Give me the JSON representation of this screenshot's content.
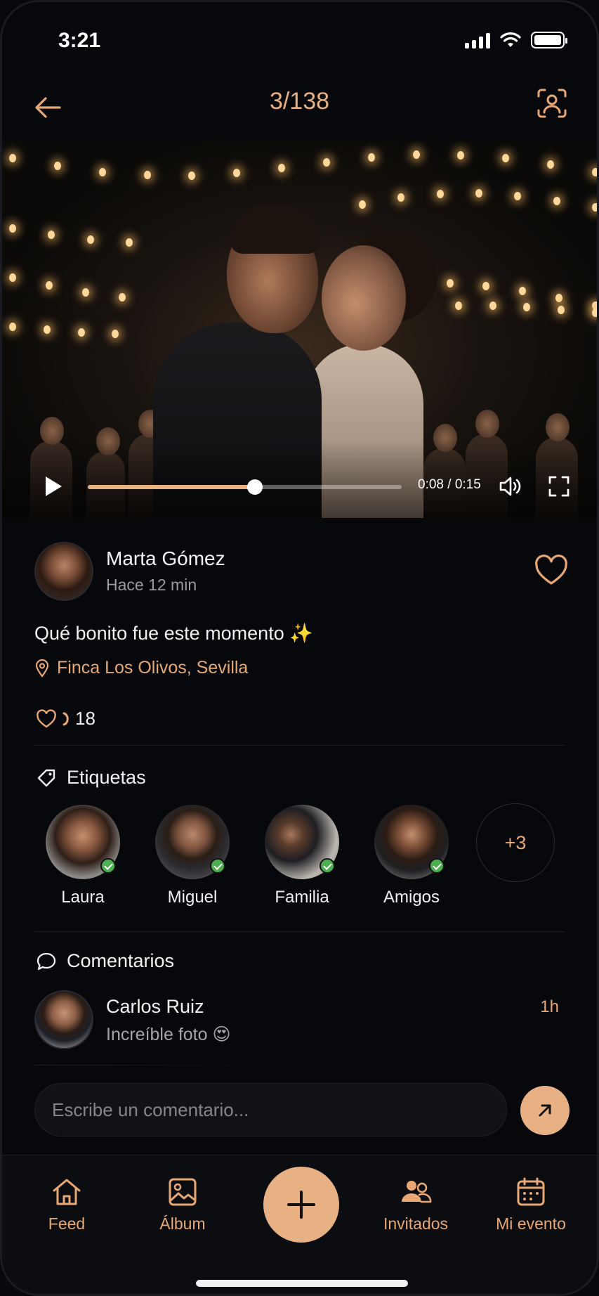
{
  "status_bar": {
    "time": "3:21"
  },
  "header": {
    "counter": "3/138"
  },
  "video": {
    "time_display": "0:08 / 0:15",
    "progress": 0.533
  },
  "post": {
    "author_name": "Marta Gómez",
    "author_time": "Hace 12 min",
    "caption": "Qué bonito fue este momento ✨",
    "location": "Finca Los Olivos, Sevilla",
    "likes_count": "18"
  },
  "tags": {
    "title": "Etiquetas",
    "items": [
      {
        "label": "Laura"
      },
      {
        "label": "Miguel"
      },
      {
        "label": "Familia"
      },
      {
        "label": "Amigos"
      }
    ],
    "more_label": "+3"
  },
  "comments": {
    "title": "Comentarios",
    "items": [
      {
        "author": "Carlos Ruiz",
        "text": "Increíble foto 😍",
        "time": "1h"
      }
    ],
    "input_placeholder": "Escribe un comentario..."
  },
  "nav": {
    "items": [
      {
        "label": "Feed",
        "icon": "home-icon"
      },
      {
        "label": "Álbum",
        "icon": "image-icon"
      },
      {
        "label": "Invitados",
        "icon": "users-icon"
      },
      {
        "label": "Mi evento",
        "icon": "calendar-icon"
      }
    ]
  },
  "colors": {
    "accent": "#e7b184",
    "accent_text": "#e7a874",
    "background": "#07080b"
  }
}
